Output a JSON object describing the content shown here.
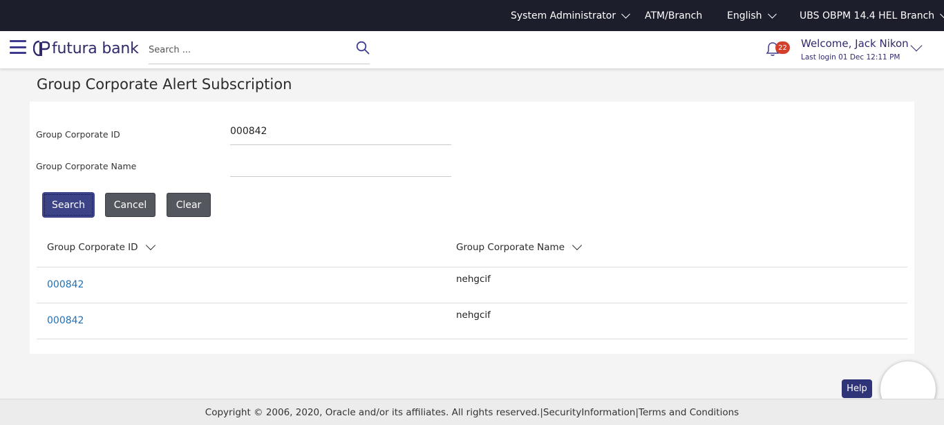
{
  "topbar": {
    "role": "System Administrator",
    "entity_type": "ATM/Branch",
    "language": "English",
    "branch": "UBS OBPM 14.4 HEL Branch"
  },
  "header": {
    "brand": "futura bank",
    "search_placeholder": "Search ...",
    "notification_count": "22",
    "welcome": "Welcome, Jack Nikon",
    "last_login": "Last login 01 Dec 12:11 PM"
  },
  "page": {
    "title": "Group Corporate Alert Subscription"
  },
  "form": {
    "group_corporate_id_label": "Group Corporate ID",
    "group_corporate_id_value": "000842",
    "group_corporate_name_label": "Group Corporate Name",
    "group_corporate_name_value": ""
  },
  "buttons": {
    "search": "Search",
    "cancel": "Cancel",
    "clear": "Clear"
  },
  "table": {
    "columns": [
      "Group Corporate ID",
      "Group Corporate Name"
    ],
    "rows": [
      {
        "id": "000842",
        "name": "nehgcif"
      },
      {
        "id": "000842",
        "name": "nehgcif"
      }
    ]
  },
  "help": {
    "label": "Help"
  },
  "footer": {
    "text": "Copyright © 2006, 2020, Oracle and/or its affiliates. All rights reserved.|SecurityInformation|Terms and Conditions"
  },
  "colors": {
    "topbar_bg": "#1d1e2c",
    "brand": "#2f2a6b",
    "primary_button": "#3d4387",
    "secondary_button": "#55575f",
    "link": "#1f6fb5",
    "badge": "#d2402c"
  },
  "icons": [
    "hamburger-icon",
    "futura-logo-icon",
    "search-icon",
    "bell-icon",
    "chevron-down-icon"
  ]
}
